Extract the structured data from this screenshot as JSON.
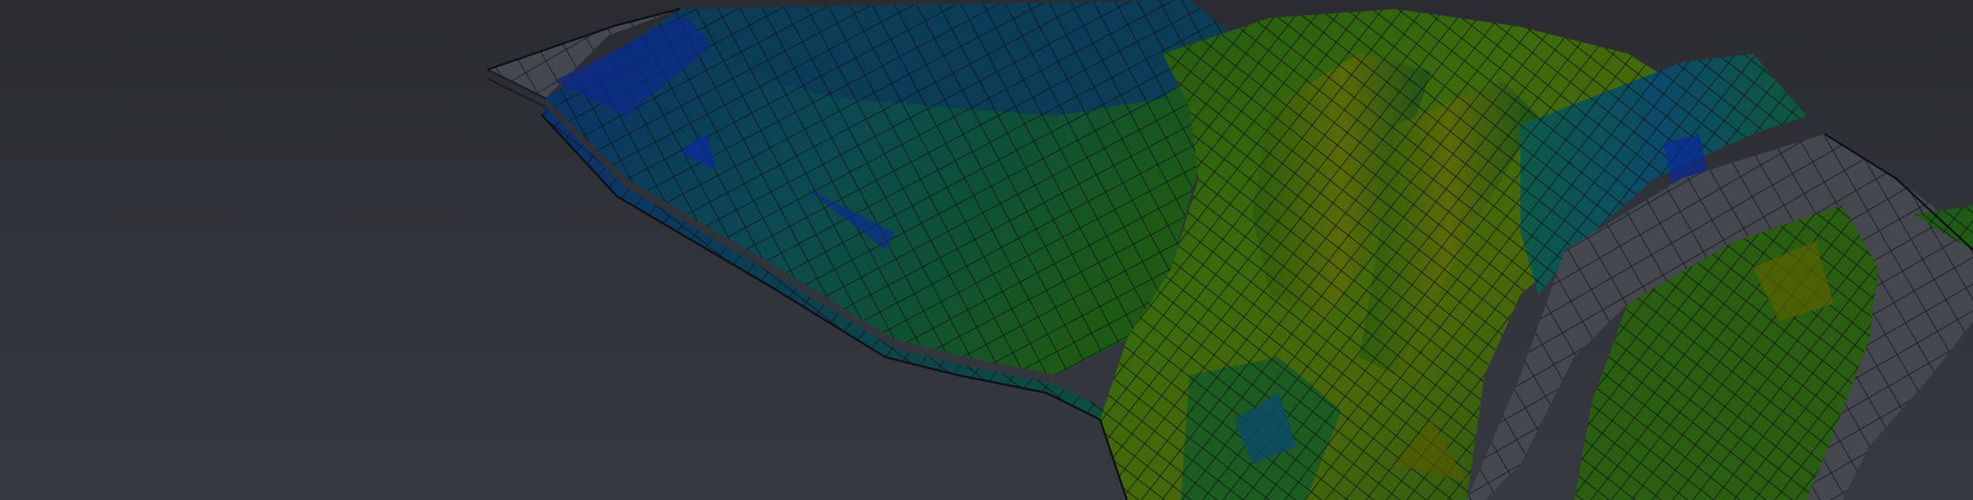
{
  "scene": {
    "subject": "fea-crush-simulation-mesh",
    "colors": {
      "background_top": "#2a2c31",
      "background_bottom": "#363940",
      "undeformed_gray": "#4a4d55",
      "mesh_line": "#11161a",
      "stress_low": "#0a2a9a",
      "stress_mid_low": "#0b4f66",
      "stress_mid": "#0f5a2a",
      "stress_mid_high": "#2f6a0a",
      "stress_high": "#6a6a00"
    }
  }
}
